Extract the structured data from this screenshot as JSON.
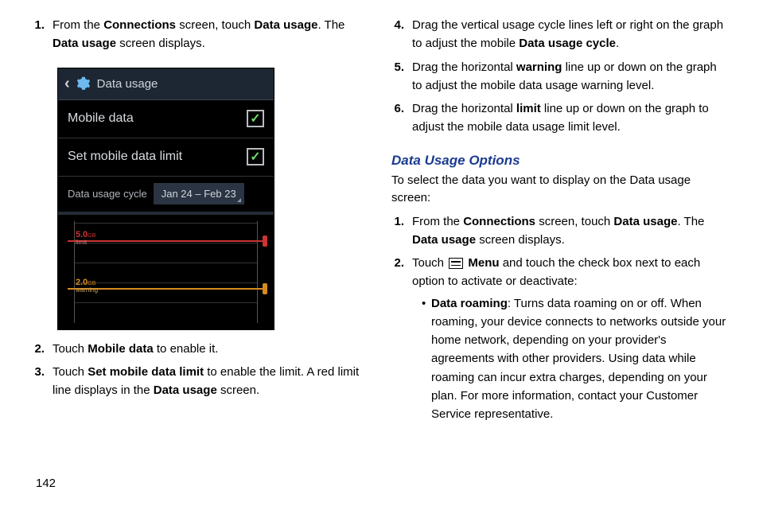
{
  "left": {
    "steps_top": [
      {
        "num": "1.",
        "pre": "From the ",
        "b1": "Connections",
        "mid": " screen, touch ",
        "b2": "Data usage",
        "post": ". The ",
        "b3": "Data usage",
        "post2": " screen displays."
      }
    ],
    "steps_bottom": [
      {
        "num": "2.",
        "pre": "Touch ",
        "b1": "Mobile data",
        "post": " to enable it."
      },
      {
        "num": "3.",
        "pre": "Touch ",
        "b1": "Set mobile data limit",
        "mid": " to enable the limit. A red limit line displays in the ",
        "b2": "Data usage",
        "post": " screen."
      }
    ]
  },
  "right": {
    "steps_top": [
      {
        "num": "4.",
        "pre": "Drag the vertical usage cycle lines left or right on the graph to adjust the mobile ",
        "b1": "Data usage cycle",
        "post": "."
      },
      {
        "num": "5.",
        "pre": "Drag the horizontal ",
        "b1": "warning",
        "post": " line up or down on the graph to adjust the mobile data usage warning level."
      },
      {
        "num": "6.",
        "pre": "Drag the horizontal ",
        "b1": "limit",
        "post": " line up or down on the graph to adjust the mobile data usage limit level."
      }
    ],
    "heading": "Data Usage Options",
    "intro": "To select the data you want to display on the Data usage screen:",
    "steps_bottom": [
      {
        "num": "1.",
        "pre": "From the ",
        "b1": "Connections",
        "mid": " screen, touch ",
        "b2": "Data usage",
        "post": ". The ",
        "b3": "Data usage",
        "post2": " screen displays."
      },
      {
        "num": "2.",
        "pre": "Touch ",
        "icon": true,
        "b1": "Menu",
        "post": " and touch the check box next to each option to activate or deactivate:"
      }
    ],
    "bullet": {
      "b1": "Data roaming",
      "post": ": Turns data roaming on or off. When roaming, your device connects to networks outside your home network, depending on your provider's agreements with other providers. Using data while roaming can incur extra charges, depending on your plan. For more information, contact your Customer Service representative."
    }
  },
  "shot": {
    "title": "Data usage",
    "row1": "Mobile data",
    "row2": "Set mobile data limit",
    "cycle_label": "Data usage cycle",
    "cycle_value": "Jan 24 – Feb 23",
    "limit_value": "5.0",
    "limit_unit": "GB",
    "limit_label": "limit",
    "warn_value": "2.0",
    "warn_unit": "GB",
    "warn_label": "warning"
  },
  "page_num": "142"
}
